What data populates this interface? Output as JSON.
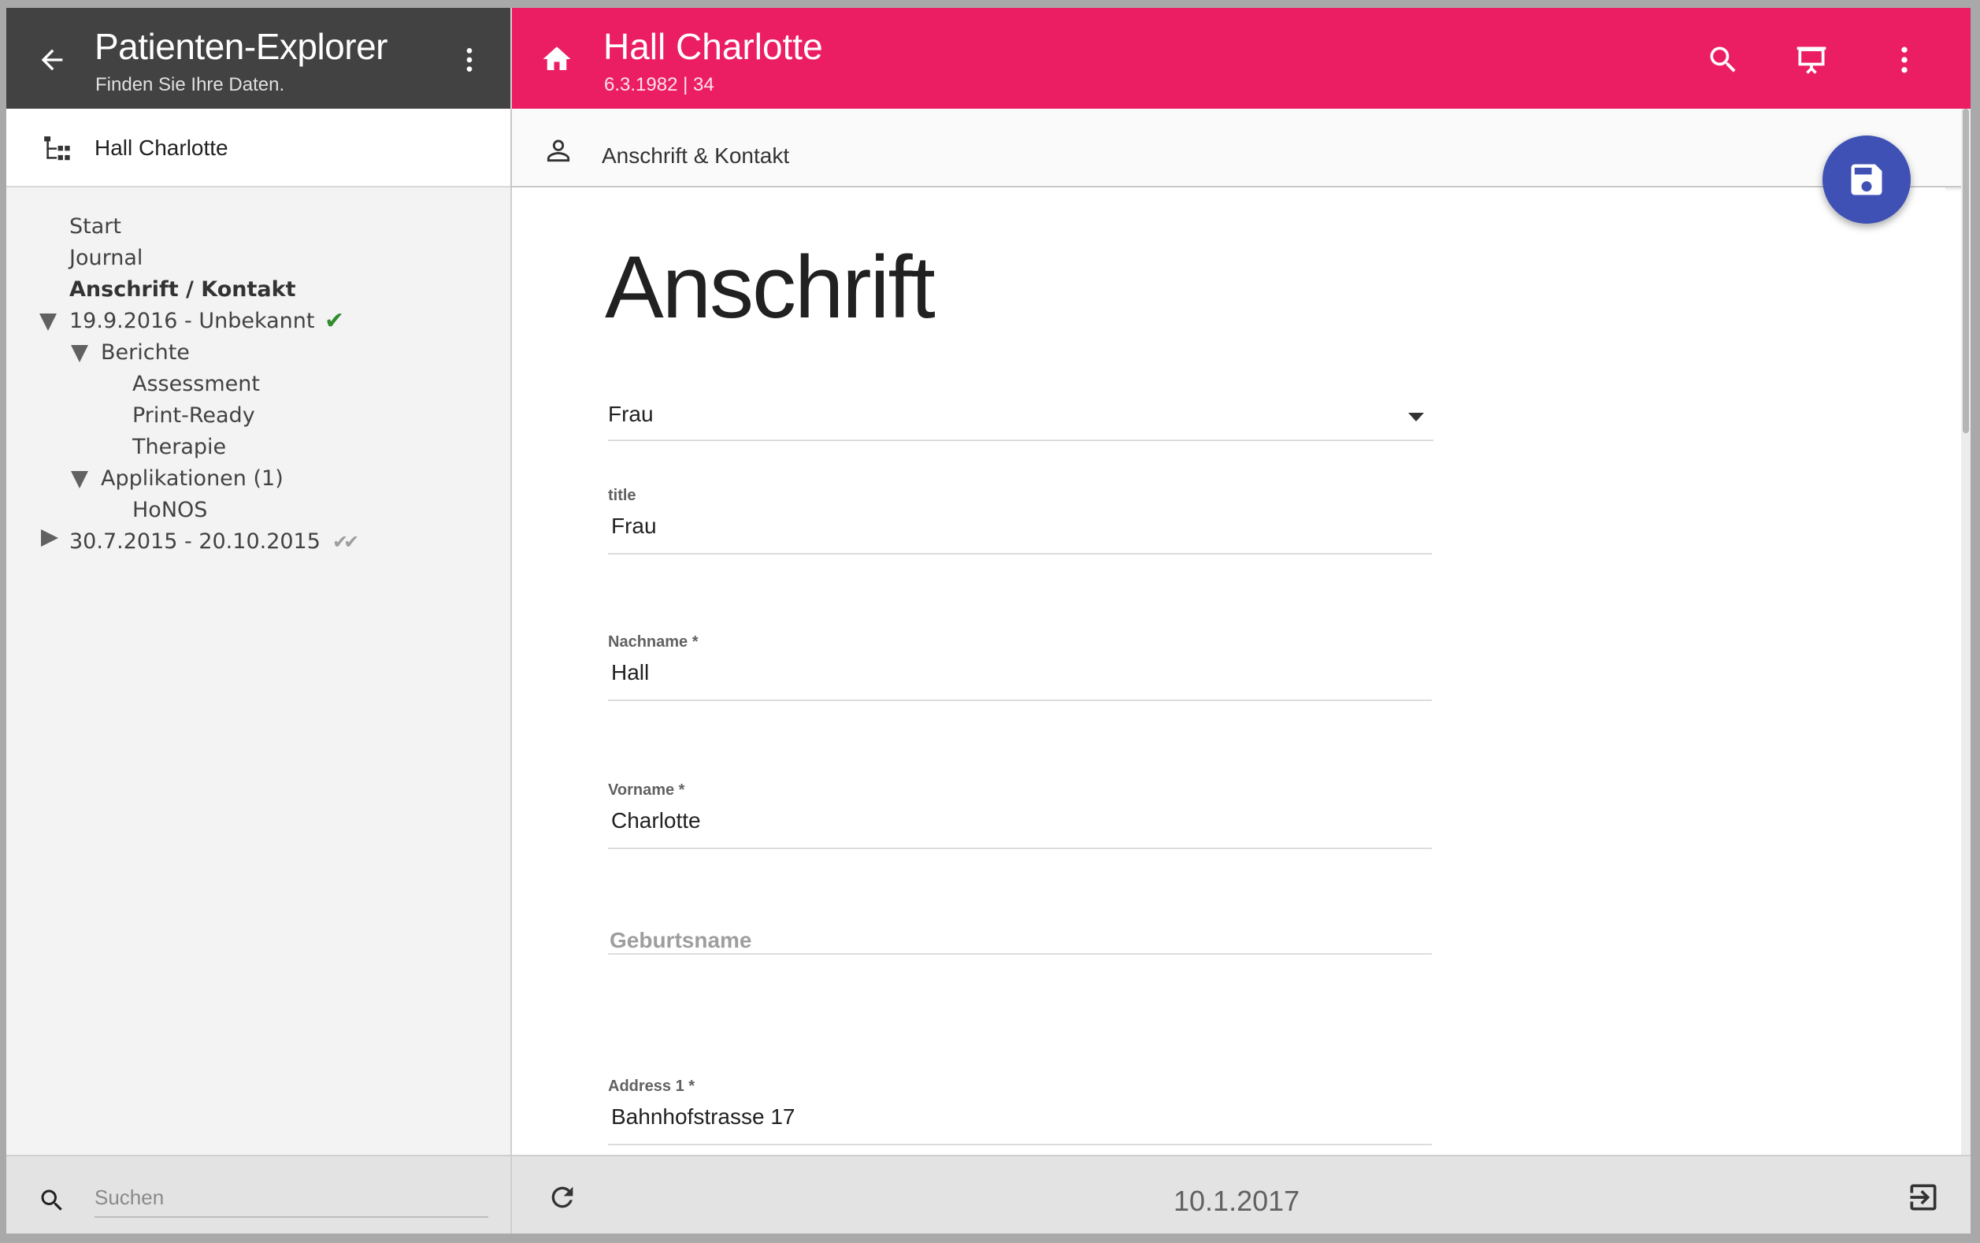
{
  "explorer": {
    "title": "Patienten-Explorer",
    "subtitle": "Finden Sie Ihre Daten.",
    "patient_label": "Hall Charlotte",
    "search_placeholder": "Suchen"
  },
  "tree": {
    "start": "Start",
    "journal": "Journal",
    "anschrift_kontakt": "Anschrift / Kontakt",
    "case1": "19.9.2016 - Unbekannt",
    "berichte": "Berichte",
    "assessment": "Assessment",
    "print_ready": "Print-Ready",
    "therapie": "Therapie",
    "applikationen": "Applikationen (1)",
    "honos": "HoNOS",
    "case2": "30.7.2015 - 20.10.2015",
    "check_single": "✔",
    "check_double": "✔✔"
  },
  "patient": {
    "name": "Hall Charlotte",
    "info": "6.3.1982 | 34"
  },
  "section": {
    "label": "Anschrift & Kontakt",
    "heading": "Anschrift"
  },
  "form": {
    "salutation": "Frau",
    "title_label": "title",
    "title_value": "Frau",
    "lastname_label": "Nachname *",
    "lastname_value": "Hall",
    "firstname_label": "Vorname *",
    "firstname_value": "Charlotte",
    "birthname_placeholder": "Geburtsname",
    "address1_label": "Address 1 *",
    "address1_value": "Bahnhofstrasse 17"
  },
  "footer": {
    "date": "10.1.2017"
  },
  "colors": {
    "left_header": "#424242",
    "right_header": "#ec1e63",
    "fab": "#3f51b5",
    "check_green": "#2e8b2e",
    "check_grey": "#9e9e9e"
  },
  "icons": [
    "arrow-back-icon",
    "more-vert-icon",
    "tree-structure-icon",
    "search-icon",
    "home-icon",
    "presentation-icon",
    "person-icon",
    "save-icon",
    "refresh-icon",
    "logout-icon"
  ]
}
